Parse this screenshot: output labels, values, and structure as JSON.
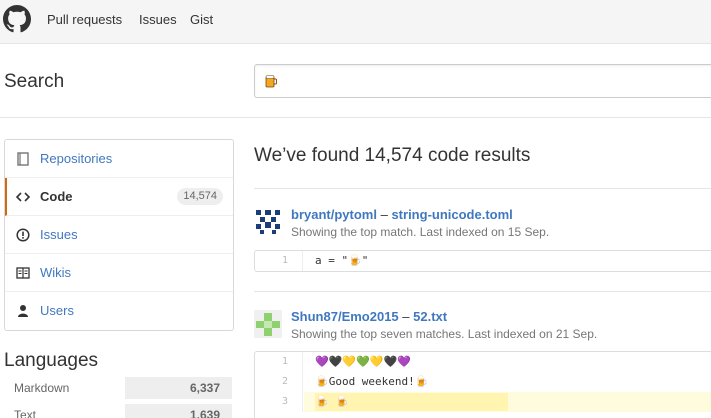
{
  "nav": {
    "links": [
      "Pull requests",
      "Issues",
      "Gist"
    ]
  },
  "search": {
    "title": "Search",
    "query_icon": "beer-emoji"
  },
  "sidebar": {
    "items": [
      {
        "label": "Repositories",
        "icon": "repo-icon",
        "count": ""
      },
      {
        "label": "Code",
        "icon": "code-icon",
        "count": "14,574"
      },
      {
        "label": "Issues",
        "icon": "issue-icon",
        "count": ""
      },
      {
        "label": "Wikis",
        "icon": "book-icon",
        "count": ""
      },
      {
        "label": "Users",
        "icon": "person-icon",
        "count": ""
      }
    ],
    "selected": "Code"
  },
  "languages": {
    "title": "Languages",
    "items": [
      {
        "name": "Markdown",
        "count": "6,337"
      },
      {
        "name": "Text",
        "count": "1,639"
      }
    ]
  },
  "results": {
    "summary": "We’ve found 14,574 code results",
    "items": [
      {
        "repo": "bryant/pytoml",
        "dash": "–",
        "file": "string-unicode.toml",
        "meta": "Showing the top match. Last indexed on 15 Sep.",
        "lines": [
          {
            "n": "1",
            "text": "a = \"🍺\""
          }
        ]
      },
      {
        "repo": "Shun87/Emo2015",
        "dash": "–",
        "file": "52.txt",
        "meta": "Showing the top seven matches. Last indexed on 21 Sep.",
        "lines": [
          {
            "n": "1",
            "text": "💜🖤💛💚💛🖤💜"
          },
          {
            "n": "2",
            "text": "🍺Good weekend!🍺"
          },
          {
            "n": "3",
            "text": "🍺 🍺"
          }
        ]
      }
    ]
  },
  "colors": {
    "link": "#4078c0",
    "selected_accent": "#d26911",
    "highlight": "#fffbdd"
  }
}
